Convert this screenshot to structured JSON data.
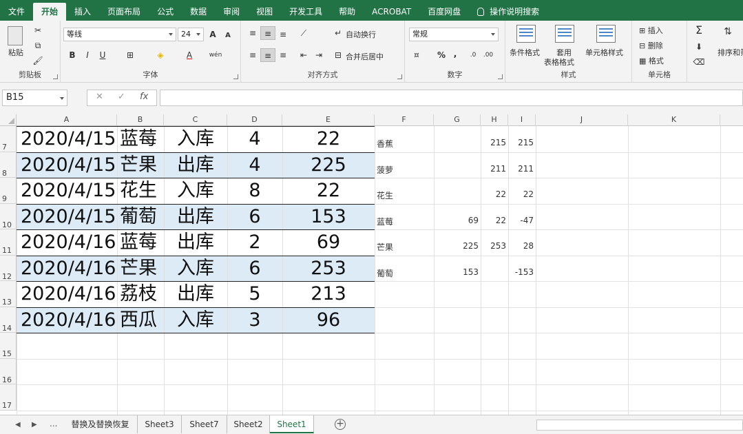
{
  "menu": {
    "tabs": [
      "文件",
      "开始",
      "插入",
      "页面布局",
      "公式",
      "数据",
      "审阅",
      "视图",
      "开发工具",
      "帮助",
      "ACROBAT",
      "百度网盘"
    ],
    "active": "开始",
    "search_label": "操作说明搜索"
  },
  "ribbon": {
    "clipboard": {
      "paste": "粘贴",
      "label": "剪贴板"
    },
    "font": {
      "name": "等线",
      "size": "24",
      "bold": "B",
      "italic": "I",
      "underline": "U",
      "grow": "A",
      "shrink": "A",
      "color": "A",
      "phonetic": "wén",
      "label": "字体"
    },
    "alignment": {
      "wrap": "自动换行",
      "merge": "合并后居中",
      "label": "对齐方式"
    },
    "number": {
      "format": "常规",
      "percent": "%",
      "comma": ",",
      "label": "数字"
    },
    "styles": {
      "conditional": "条件格式",
      "table1": "套用",
      "table2": "表格格式",
      "cell_styles": "单元格样式",
      "label": "样式"
    },
    "cells": {
      "insert": "插入",
      "delete": "删除",
      "format": "格式",
      "label": "单元格"
    },
    "editing": {
      "sum": "Σ",
      "sort": "排序和筛"
    }
  },
  "formula_bar": {
    "name_box": "B15",
    "cancel": "✕",
    "enter": "✓",
    "fx": "fx",
    "value": ""
  },
  "columns": [
    "A",
    "B",
    "C",
    "D",
    "E",
    "F",
    "G",
    "H",
    "I",
    "J",
    "K"
  ],
  "rows": [
    "7",
    "8",
    "9",
    "10",
    "11",
    "12",
    "13",
    "14",
    "15",
    "16",
    "17"
  ],
  "table": [
    {
      "date": "2020/4/15",
      "item": "蓝莓",
      "type": "入库",
      "qty": "4",
      "amount": "22"
    },
    {
      "date": "2020/4/15",
      "item": "芒果",
      "type": "出库",
      "qty": "4",
      "amount": "225"
    },
    {
      "date": "2020/4/15",
      "item": "花生",
      "type": "入库",
      "qty": "8",
      "amount": "22"
    },
    {
      "date": "2020/4/15",
      "item": "葡萄",
      "type": "出库",
      "qty": "6",
      "amount": "153"
    },
    {
      "date": "2020/4/16",
      "item": "蓝莓",
      "type": "出库",
      "qty": "2",
      "amount": "69"
    },
    {
      "date": "2020/4/16",
      "item": "芒果",
      "type": "入库",
      "qty": "6",
      "amount": "253"
    },
    {
      "date": "2020/4/16",
      "item": "荔枝",
      "type": "出库",
      "qty": "5",
      "amount": "213"
    },
    {
      "date": "2020/4/16",
      "item": "西瓜",
      "type": "入库",
      "qty": "3",
      "amount": "96"
    }
  ],
  "summary": [
    {
      "f": "香蕉",
      "g": "",
      "h": "215",
      "i": "215"
    },
    {
      "f": "菠萝",
      "g": "",
      "h": "211",
      "i": "211"
    },
    {
      "f": "花生",
      "g": "",
      "h": "22",
      "i": "22"
    },
    {
      "f": "蓝莓",
      "g": "69",
      "h": "22",
      "i": "-47"
    },
    {
      "f": "芒果",
      "g": "225",
      "h": "253",
      "i": "28"
    },
    {
      "f": "葡萄",
      "g": "153",
      "h": "",
      "i": "-153"
    }
  ],
  "sheets": {
    "ellipsis": "...",
    "tabs": [
      "替换及替换恢复",
      "Sheet3",
      "Sheet7",
      "Sheet2",
      "Sheet1"
    ],
    "active": "Sheet1"
  },
  "colors": {
    "excel_green": "#217346",
    "band": "#ddebf7"
  }
}
